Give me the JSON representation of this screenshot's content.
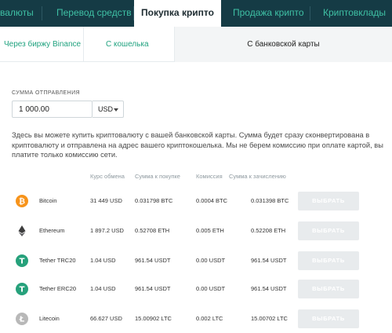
{
  "top_nav": [
    {
      "label": "валюты",
      "active": false
    },
    {
      "label": "Перевод средств",
      "active": false
    },
    {
      "label": "Покупка крипто",
      "active": true
    },
    {
      "label": "Продажа крипто",
      "active": false
    },
    {
      "label": "Криптовклады",
      "active": false
    }
  ],
  "sub_tabs": [
    {
      "label": "Через биржу Binance",
      "active": false
    },
    {
      "label": "С кошелька",
      "active": false
    },
    {
      "label": "С банковской карты",
      "active": true
    }
  ],
  "amount": {
    "label": "СУММА ОТПРАВЛЕНИЯ",
    "value": "1 000.00",
    "currency": "USD"
  },
  "description": "Здесь вы можете купить криптовалюту с вашей банковской карты. Сумма будет сразу сконвертирована в криптовалюту и отправлена на адрес вашего криптокошелька. Мы не берем комиссию при оплате картой, вы платите только комиссию сети.",
  "table": {
    "headers": [
      "Курс обмена",
      "Сумма к покупке",
      "Комиссия",
      "Сумма к зачислению"
    ],
    "button_label": "ВЫБРАТЬ",
    "rows": [
      {
        "icon": "bitcoin-icon",
        "color": "#f7931a",
        "symbol": "₿",
        "name": "Bitcoin",
        "rate": "31 449 USD",
        "buy": "0.031798 BTC",
        "fee": "0.0004 BTC",
        "credit": "0.031398 BTC"
      },
      {
        "icon": "ethereum-icon",
        "color": "#3c3c3d",
        "symbol": "",
        "name": "Ethereum",
        "rate": "1 897.2 USD",
        "buy": "0.52708 ETH",
        "fee": "0.005 ETH",
        "credit": "0.52208 ETH"
      },
      {
        "icon": "tether-icon",
        "color": "#26a17b",
        "symbol": "T",
        "name": "Tether TRC20",
        "rate": "1.04 USD",
        "buy": "961.54 USDT",
        "fee": "0.00 USDT",
        "credit": "961.54 USDT"
      },
      {
        "icon": "tether-icon",
        "color": "#26a17b",
        "symbol": "T",
        "name": "Tether ERC20",
        "rate": "1.04 USD",
        "buy": "961.54 USDT",
        "fee": "0.00 USDT",
        "credit": "961.54 USDT"
      },
      {
        "icon": "litecoin-icon",
        "color": "#b8b8b8",
        "symbol": "Ł",
        "name": "Litecoin",
        "rate": "66.627 USD",
        "buy": "15.00902 LTC",
        "fee": "0.002 LTC",
        "credit": "15.00702 LTC"
      }
    ]
  }
}
